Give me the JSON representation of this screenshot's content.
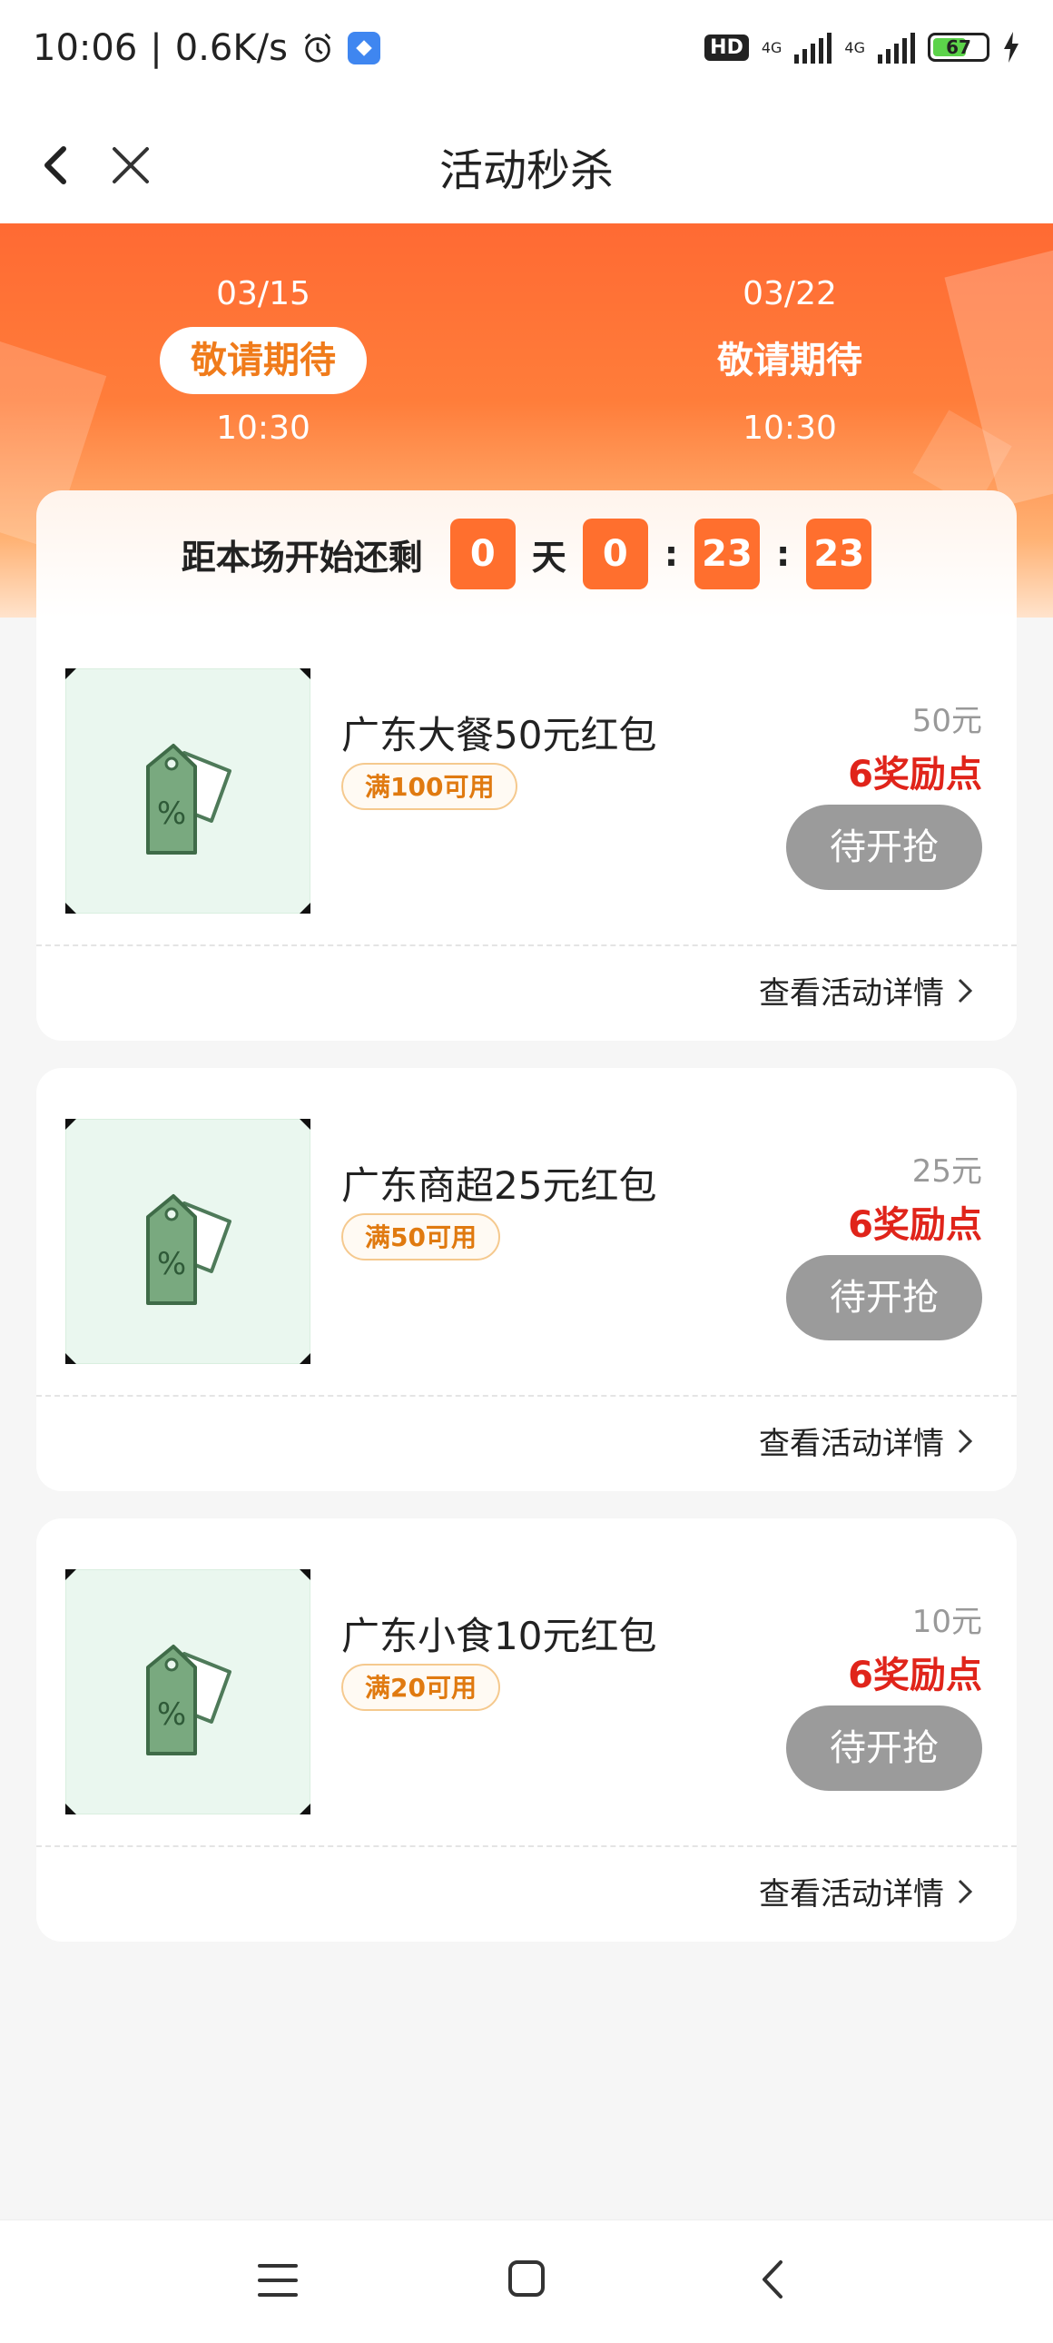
{
  "status_bar": {
    "time": "10:06",
    "net_speed": "0.6K/s",
    "hd_label": "HD",
    "net1": "4G",
    "net2": "4G",
    "battery": "67"
  },
  "header": {
    "title": "活动秒杀"
  },
  "sessions": [
    {
      "date": "03/15",
      "status": "敬请期待",
      "time": "10:30",
      "active": true
    },
    {
      "date": "03/22",
      "status": "敬请期待",
      "time": "10:30",
      "active": false
    }
  ],
  "countdown": {
    "label": "距本场开始还剩",
    "days": "0",
    "day_unit": "天",
    "hours": "0",
    "sep1": ":",
    "minutes": "23",
    "sep2": ":",
    "seconds": "23"
  },
  "items": [
    {
      "name": "广东大餐50元红包",
      "condition": "满100可用",
      "face_value": "50元",
      "points": "6奖励点",
      "button": "待开抢",
      "detail": "查看活动详情"
    },
    {
      "name": "广东商超25元红包",
      "condition": "满50可用",
      "face_value": "25元",
      "points": "6奖励点",
      "button": "待开抢",
      "detail": "查看活动详情"
    },
    {
      "name": "广东小食10元红包",
      "condition": "满20可用",
      "face_value": "10元",
      "points": "6奖励点",
      "button": "待开抢",
      "detail": "查看活动详情"
    }
  ],
  "colors": {
    "accent_orange": "#ff6f2e",
    "points_red": "#e0241a",
    "button_gray": "#9b9b9b",
    "tag_orange": "#e07a10"
  },
  "icons": {
    "back": "chevron-left-icon",
    "close": "close-icon",
    "alarm": "alarm-icon",
    "coupon": "price-tag-icon",
    "chevron": "chevron-right-icon",
    "nav_menu": "menu-icon",
    "nav_home": "home-square-icon",
    "nav_back": "back-icon"
  }
}
